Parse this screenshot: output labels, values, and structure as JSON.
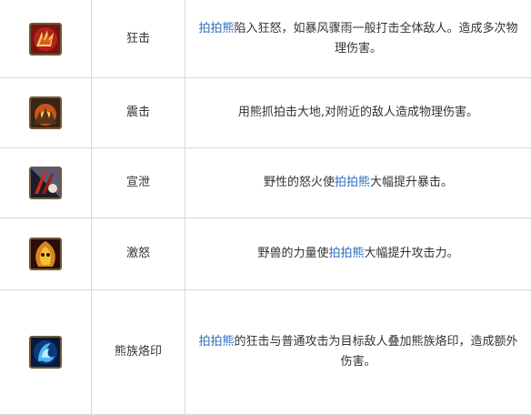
{
  "skills": [
    {
      "name": "狂击",
      "icon": "rage-claw-icon",
      "desc": [
        {
          "text": "拍拍熊",
          "hl": true
        },
        {
          "text": "陷入狂怒，如暴风骤雨一般打击全体敌人。造成多次物理伤害。",
          "hl": false
        }
      ]
    },
    {
      "name": "震击",
      "icon": "ground-slam-icon",
      "desc": [
        {
          "text": "用熊抓拍击大地,对附近的敌人造成物理伤害。",
          "hl": false
        }
      ]
    },
    {
      "name": "宣泄",
      "icon": "vent-fury-icon",
      "desc": [
        {
          "text": "野性的怒火使",
          "hl": false
        },
        {
          "text": "拍拍熊",
          "hl": true
        },
        {
          "text": "大幅提升暴击。",
          "hl": false
        }
      ]
    },
    {
      "name": "激怒",
      "icon": "enrage-icon",
      "desc": [
        {
          "text": "野兽的力量使",
          "hl": false
        },
        {
          "text": "拍拍熊",
          "hl": true
        },
        {
          "text": "大幅提升攻击力。",
          "hl": false
        }
      ]
    },
    {
      "name": "熊族烙印",
      "icon": "bear-mark-icon",
      "desc": [
        {
          "text": "拍拍熊",
          "hl": true
        },
        {
          "text": "的狂击与普通攻击为目标敌人叠加熊族烙印，造成额外伤害。",
          "hl": false
        }
      ]
    }
  ],
  "colors": {
    "link": "#2b6fc2",
    "text": "#333333",
    "border": "#d8d8d8"
  }
}
